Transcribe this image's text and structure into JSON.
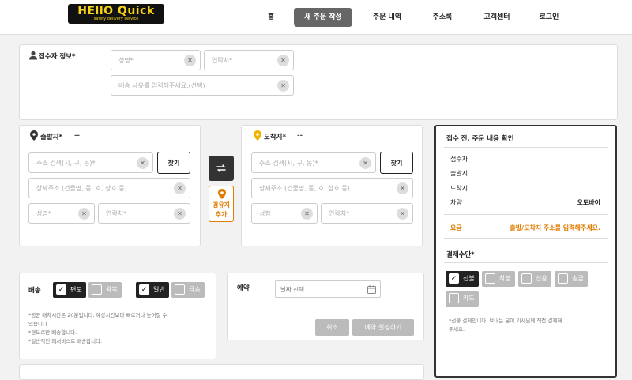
{
  "header": {
    "logo_text": "HEllO Quick",
    "logo_subtext": "safety delivery service",
    "nav": [
      "홈",
      "새 주문 작성",
      "주문 내역",
      "주소록",
      "고객센터",
      "로그인"
    ]
  },
  "recipient": {
    "label": "접수자 정보*",
    "name_placeholder": "성명*",
    "contact_placeholder": "연락처*",
    "reason_placeholder": "배송 사유를 입력해주세요.(선택)"
  },
  "origin": {
    "label": "출발지*",
    "dash": "--",
    "address_placeholder": "주소 검색(시, 구, 동)*",
    "find_label": "찾기",
    "detail_placeholder": "상세주소 (건물명, 동, 호, 상호 등)",
    "name_placeholder": "성명*",
    "contact_placeholder": "연락처*"
  },
  "destination": {
    "label": "도착지*",
    "dash": "--",
    "address_placeholder": "주소 검색(시, 구, 동)*",
    "find_label": "찾기",
    "detail_placeholder": "상세주소 (건물명, 동, 호, 상호 등)",
    "name_placeholder": "성함",
    "contact_placeholder": "연락처*"
  },
  "swap": {
    "icon": "swap-icon"
  },
  "waypoint": {
    "line1": "경유지",
    "line2": "추가"
  },
  "delivery": {
    "label": "배송",
    "options": [
      "편도",
      "왕복",
      "일반",
      "급송"
    ],
    "checked": [
      true,
      false,
      true,
      false
    ],
    "notes": [
      "*평균 배차시간은 20분입니다. 예상시간보다 빠르거나 늦어질 수",
      "있습니다.",
      "*편도로만 배송합니다.",
      "*일반적인 쾌서비스로 배송합니다."
    ]
  },
  "reservation": {
    "label": "예약",
    "date_placeholder": "날짜 선택",
    "cancel_label": "취소",
    "set_label": "예약 설정하기"
  },
  "summary": {
    "title": "접수 전, 주문 내용 확인",
    "rows": [
      "접수자",
      "출발지",
      "도착지"
    ],
    "vehicle_label": "차량",
    "vehicle_value": "오토바이",
    "fee_label": "요금",
    "fee_value": "출발/도착지 주소를 입력해주세요.",
    "payment_label": "결제수단*",
    "payment_options": [
      "선불",
      "착불",
      "신용",
      "송금",
      "카드"
    ],
    "payment_checked": [
      true,
      false,
      false,
      false,
      false
    ],
    "payment_note_1": "*선불 결제입니다. 보내는 분이 기사님께 직접 결제해",
    "payment_note_2": "주세요.",
    "accent_color": "#e07b00"
  }
}
